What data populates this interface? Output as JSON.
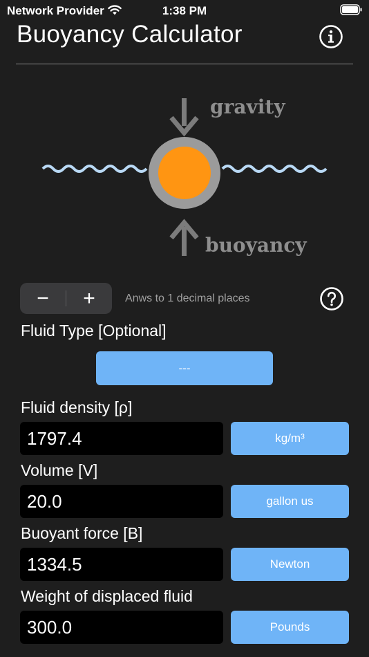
{
  "status_bar": {
    "carrier": "Network Provider",
    "time": "1:38 PM"
  },
  "header": {
    "title": "Buoyancy Calculator"
  },
  "diagram": {
    "gravity_label": "gravity",
    "buoyancy_label": "buoyancy",
    "colors": {
      "water": "#b9d9f5",
      "ball": "#ff9512",
      "ring": "#9b9b9b",
      "arrow": "#8e8e8e"
    }
  },
  "precision": {
    "minus_label": "−",
    "plus_label": "+",
    "hint": "Anws to 1 decimal places"
  },
  "fluid_type": {
    "label": "Fluid Type [Optional]",
    "selected": "---"
  },
  "fields": {
    "density": {
      "label": "Fluid density [ρ]",
      "value": "1797.4",
      "unit": "kg/m³"
    },
    "volume": {
      "label": "Volume [V]",
      "value": "20.0",
      "unit": "gallon us"
    },
    "buoyant_force": {
      "label": "Buoyant force [B]",
      "value": "1334.5",
      "unit": "Newton"
    },
    "weight": {
      "label": "Weight of displaced fluid",
      "value": "300.0",
      "unit": "Pounds"
    }
  },
  "theme": {
    "background": "#1e1e1e",
    "accent": "#6fb4f7",
    "field_bg": "#000000"
  }
}
